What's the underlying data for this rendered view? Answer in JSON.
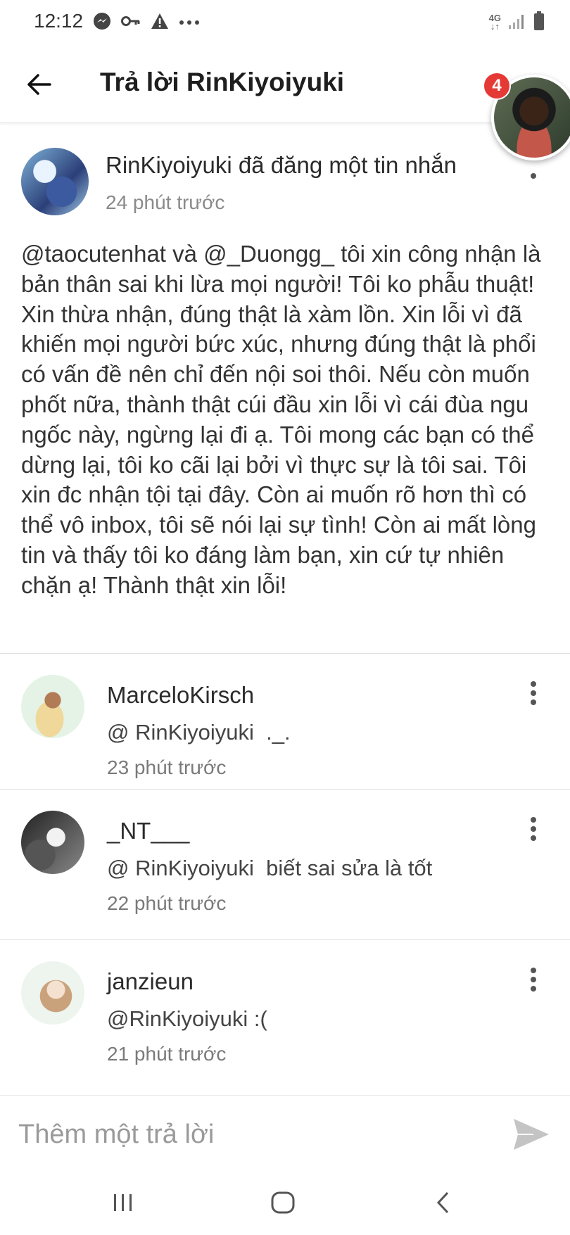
{
  "status_bar": {
    "time": "12:12",
    "network": "4G",
    "icons": [
      "messenger-icon",
      "key-icon",
      "warning-icon",
      "more-dots-icon",
      "signal-icon",
      "battery-icon"
    ]
  },
  "app_bar": {
    "title": "Trả lời RinKiyoiyuki",
    "back_icon": "arrow-left-icon"
  },
  "chat_head": {
    "badge_count": "4"
  },
  "post": {
    "author_line": "RinKiyoiyuki đã đăng một tin nhắn",
    "time": "24 phút trước",
    "body": "@taocutenhat và @_Duongg_ tôi xin công nhận là bản thân sai khi lừa mọi người! Tôi ko phẫu thuật! Xin thừa nhận, đúng thật là xàm lồn. Xin lỗi vì đã khiến mọi người bức xúc, nhưng đúng thật là phổi có vấn đề nên chỉ đến nội soi thôi. Nếu còn muốn phốt nữa, thành thật cúi đầu xin lỗi vì cái đùa ngu ngốc này, ngừng lại đi ạ. Tôi mong các bạn có thể dừng lại, tôi ko cãi lại bởi vì thực sự là tôi sai. Tôi xin đc nhận tội tại đây. Còn ai muốn rõ hơn thì có thể vô inbox, tôi sẽ nói lại sự tình! Còn ai mất lòng tin và thấy tôi ko đáng làm bạn, xin cứ tự nhiên chặn ạ! Thành thật xin lỗi!"
  },
  "replies": [
    {
      "name": "MarceloKirsch",
      "text": "@ RinKiyoiyuki  ._.",
      "time": "23 phút trước"
    },
    {
      "name": "_NT___",
      "text": "@ RinKiyoiyuki  biết sai sửa là tốt",
      "time": "22 phút trước"
    },
    {
      "name": "janzieun",
      "text": "@RinKiyoiyuki :(",
      "time": "21 phút trước"
    }
  ],
  "composer": {
    "placeholder": "Thêm một trả lời"
  },
  "colors": {
    "divider": "#e0e0e0",
    "badge": "#e53935",
    "secondary_text": "#8a8a8a"
  }
}
